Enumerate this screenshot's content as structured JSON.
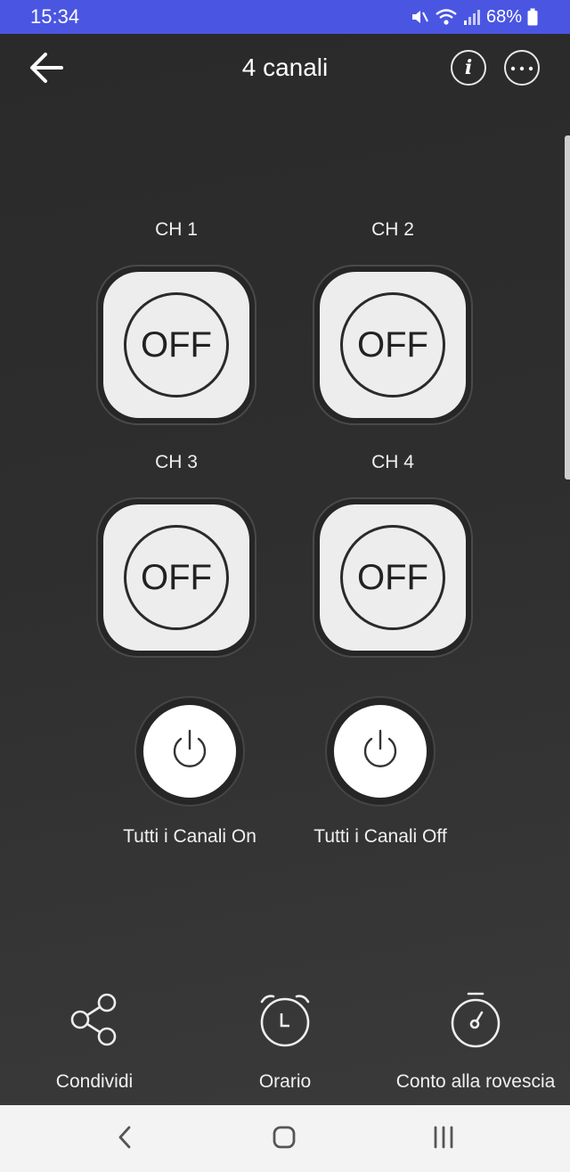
{
  "status_bar": {
    "time": "15:34",
    "battery": "68%",
    "icons": [
      "mute-icon",
      "wifi-icon",
      "signal-icon",
      "battery-icon"
    ]
  },
  "header": {
    "title": "4 canali",
    "back_icon": "arrow-left-icon",
    "info_icon": "info-icon",
    "more_icon": "more-icon"
  },
  "channels": [
    {
      "label": "CH 1",
      "state": "OFF"
    },
    {
      "label": "CH 2",
      "state": "OFF"
    },
    {
      "label": "CH 3",
      "state": "OFF"
    },
    {
      "label": "CH 4",
      "state": "OFF"
    }
  ],
  "all_controls": {
    "on_label": "Tutti i Canali On",
    "off_label": "Tutti i Canali Off",
    "icon": "power-icon"
  },
  "actions": [
    {
      "label": "Condividi",
      "icon": "share-icon"
    },
    {
      "label": "Orario",
      "icon": "alarm-clock-icon"
    },
    {
      "label": "Conto alla rovescia",
      "icon": "stopwatch-icon"
    }
  ],
  "colors": {
    "status_bar": "#4a56e2",
    "background": "#2b2b2b",
    "button_face": "#ededed",
    "nav_bar": "#f3f3f3"
  }
}
